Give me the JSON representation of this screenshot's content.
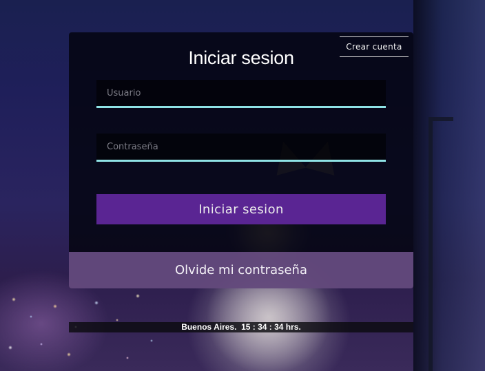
{
  "header": {
    "create_account_label": "Crear cuenta"
  },
  "login": {
    "title": "Iniciar sesion",
    "username_placeholder": "Usuario",
    "password_placeholder": "Contraseña",
    "submit_label": "Iniciar sesion",
    "forgot_password_label": "Olvide mi contraseña"
  },
  "footer": {
    "clock_text": "Buenos Aires.  15 : 34 : 34 hrs."
  },
  "colors": {
    "field_underline": "#8fe3e6",
    "submit_button": "#5a2593",
    "forgot_bar": "#825fa0"
  }
}
